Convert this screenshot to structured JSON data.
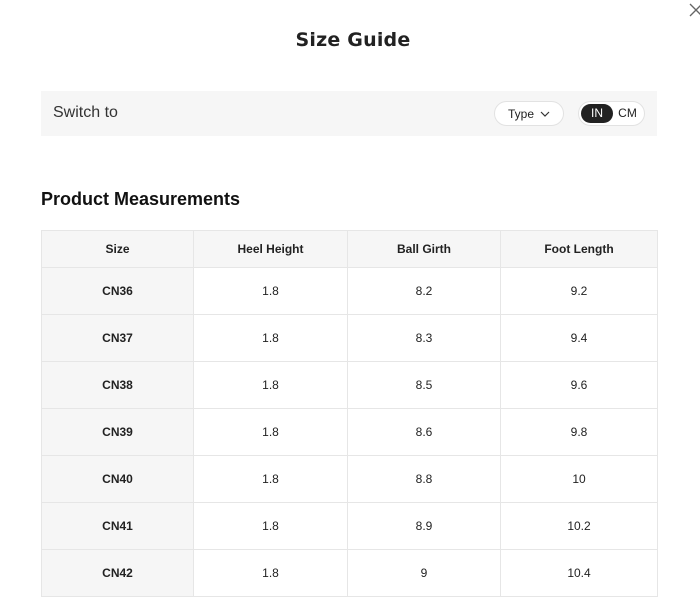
{
  "modal": {
    "title": "Size Guide",
    "close_icon": "close-icon"
  },
  "switch_bar": {
    "label": "Switch to",
    "type_button": {
      "label": "Type",
      "icon": "chevron-down-icon"
    },
    "units": [
      {
        "label": "IN",
        "active": true
      },
      {
        "label": "CM",
        "active": false
      }
    ]
  },
  "section": {
    "title": "Product Measurements"
  },
  "table": {
    "columns": [
      "Size",
      "Heel Height",
      "Ball Girth",
      "Foot Length"
    ],
    "rows": [
      [
        "CN36",
        "1.8",
        "8.2",
        "9.2"
      ],
      [
        "CN37",
        "1.8",
        "8.3",
        "9.4"
      ],
      [
        "CN38",
        "1.8",
        "8.5",
        "9.6"
      ],
      [
        "CN39",
        "1.8",
        "8.6",
        "9.8"
      ],
      [
        "CN40",
        "1.8",
        "8.8",
        "10"
      ],
      [
        "CN41",
        "1.8",
        "8.9",
        "10.2"
      ],
      [
        "CN42",
        "1.8",
        "9",
        "10.4"
      ]
    ]
  },
  "colors": {
    "active_toggle_bg": "#222222",
    "bar_bg": "#f6f6f6",
    "border": "#e6e6e6"
  }
}
